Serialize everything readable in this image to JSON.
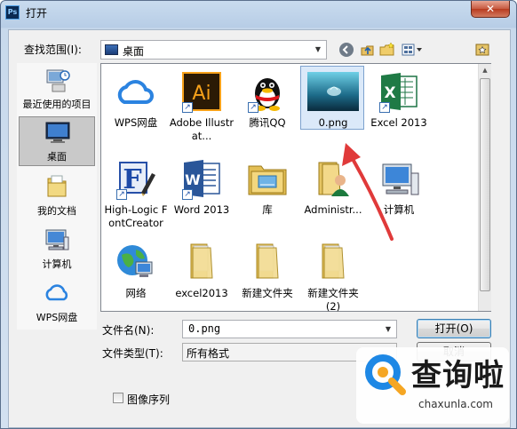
{
  "window": {
    "app_icon": "Ps",
    "title": "打开",
    "close_glyph": "✕"
  },
  "lookin": {
    "label": "查找范围(I):",
    "value": "桌面",
    "arrow": "▼"
  },
  "toolbar": {
    "back_icon": "back-icon",
    "up_icon": "up-folder-icon",
    "new_folder_icon": "new-folder-icon",
    "view_menu_icon": "view-menu-icon"
  },
  "places": [
    {
      "label": "最近使用的项目",
      "icon": "recent-icon",
      "selected": false
    },
    {
      "label": "桌面",
      "icon": "desktop-icon",
      "selected": true
    },
    {
      "label": "我的文档",
      "icon": "documents-icon",
      "selected": false
    },
    {
      "label": "计算机",
      "icon": "computer-icon",
      "selected": false
    },
    {
      "label": "WPS网盘",
      "icon": "cloud-icon",
      "selected": false
    }
  ],
  "items": [
    {
      "name": "WPS网盘",
      "icon": "cloud-icon",
      "shortcut": false
    },
    {
      "name": "Adobe Illustrat...",
      "icon": "illustrator-icon",
      "shortcut": true
    },
    {
      "name": "腾讯QQ",
      "icon": "qq-icon",
      "shortcut": true
    },
    {
      "name": "0.png",
      "icon": "image-thumbnail-icon",
      "shortcut": false,
      "selected": true
    },
    {
      "name": "Excel 2013",
      "icon": "excel-icon",
      "shortcut": true
    },
    {
      "name": "High-Logic FontCreator",
      "icon": "fontcreator-icon",
      "shortcut": true
    },
    {
      "name": "Word 2013",
      "icon": "word-icon",
      "shortcut": true
    },
    {
      "name": "库",
      "icon": "library-icon",
      "shortcut": false
    },
    {
      "name": "Administr...",
      "icon": "user-folder-icon",
      "shortcut": false
    },
    {
      "name": "计算机",
      "icon": "computer-icon",
      "shortcut": false
    },
    {
      "name": "网络",
      "icon": "network-icon",
      "shortcut": false
    },
    {
      "name": "excel2013",
      "icon": "folder-icon",
      "shortcut": false
    },
    {
      "name": "新建文件夹",
      "icon": "folder-icon",
      "shortcut": false
    },
    {
      "name": "新建文件夹 (2)",
      "icon": "folder-icon",
      "shortcut": false
    }
  ],
  "filename": {
    "label": "文件名(N):",
    "value": "0.png",
    "arrow": "▼"
  },
  "filetype": {
    "label": "文件类型(T):",
    "value": "所有格式"
  },
  "buttons": {
    "open": "打开(O)",
    "cancel": "取消"
  },
  "sequence_checkbox": {
    "label": "图像序列",
    "checked": false
  },
  "watermark": {
    "text": "查询啦",
    "url": "chaxunla.com"
  },
  "colors": {
    "selection": "#dbe9f9",
    "annotation_arrow": "#e03a3a",
    "watermark_blue": "#1e88e5",
    "watermark_orange": "#f5a623"
  }
}
